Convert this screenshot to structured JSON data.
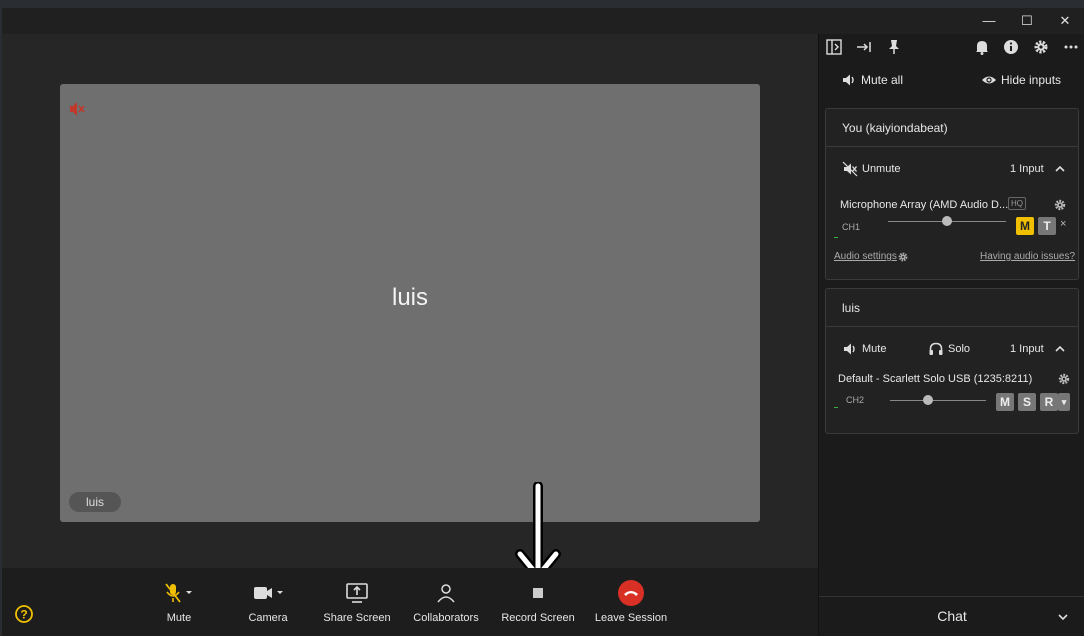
{
  "window": {
    "minimize": "—",
    "maximize": "☐",
    "close": "✕"
  },
  "video": {
    "participant_name": "luis",
    "chip_label": "luis"
  },
  "toolbar": {
    "mute": "Mute",
    "camera": "Camera",
    "share_screen": "Share Screen",
    "collaborators": "Collaborators",
    "record_screen": "Record Screen",
    "leave_session": "Leave Session"
  },
  "sidebar": {
    "mute_all": "Mute all",
    "hide_inputs": "Hide inputs",
    "you_panel": {
      "title": "You (kaiyiondabeat)",
      "unmute": "Unmute",
      "inputs": "1 Input",
      "device": "Microphone Array (AMD Audio D...",
      "hq": "HQ",
      "channel": "CH1",
      "slider_level": 0.5,
      "m_btn": "M",
      "t_btn": "T",
      "remove": "×",
      "audio_settings": "Audio settings",
      "audio_issues": "Having audio issues?"
    },
    "luis_panel": {
      "title": "luis",
      "mute": "Mute",
      "solo": "Solo",
      "inputs": "1 Input",
      "device": "Default - Scarlett Solo USB (1235:8211)",
      "channel": "CH2",
      "slider_level": 0.4,
      "m_btn": "M",
      "s_btn": "S",
      "r_btn": "R",
      "dropdown": "▾"
    },
    "chat": "Chat"
  },
  "colors": {
    "accent_yellow": "#f0c000",
    "leave_red": "#d93025",
    "muted_red": "#c0392b"
  }
}
